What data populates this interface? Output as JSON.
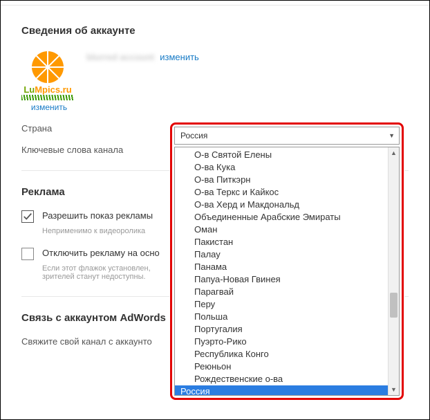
{
  "section_account": {
    "title": "Сведения об аккаунте",
    "logo_text_1": "Lu",
    "logo_text_2": "M",
    "logo_text_3": "pics.ru",
    "blurred_name": "blurred account",
    "change_link": "изменить",
    "avatar_change": "изменить",
    "country_label": "Страна",
    "keywords_label": "Ключевые слова канала"
  },
  "section_ads": {
    "title": "Реклама",
    "allow_label": "Разрешить показ рекламы",
    "allow_hint": "Неприменимо к видеоролика",
    "disable_label": "Отключить рекламу на осно",
    "disable_hint": "Если этот флажок установлен,\nзрителей станут недоступны."
  },
  "section_adwords": {
    "title": "Связь с аккаунтом AdWords",
    "para": "Свяжите свой канал с аккаунто"
  },
  "dropdown": {
    "selected": "Россия",
    "items": [
      "О-в Святой Елены",
      "О-ва Кука",
      "О-ва Питкэрн",
      "О-ва Теркс и Кайкос",
      "О-ва Херд и Макдональд",
      "Объединенные Арабские Эмираты",
      "Оман",
      "Пакистан",
      "Палау",
      "Панама",
      "Папуа-Новая Гвинея",
      "Парагвай",
      "Перу",
      "Польша",
      "Португалия",
      "Пуэрто-Рико",
      "Республика Конго",
      "Реюньон",
      "Рождественские о-ва",
      "Россия"
    ],
    "selected_index": 19
  }
}
